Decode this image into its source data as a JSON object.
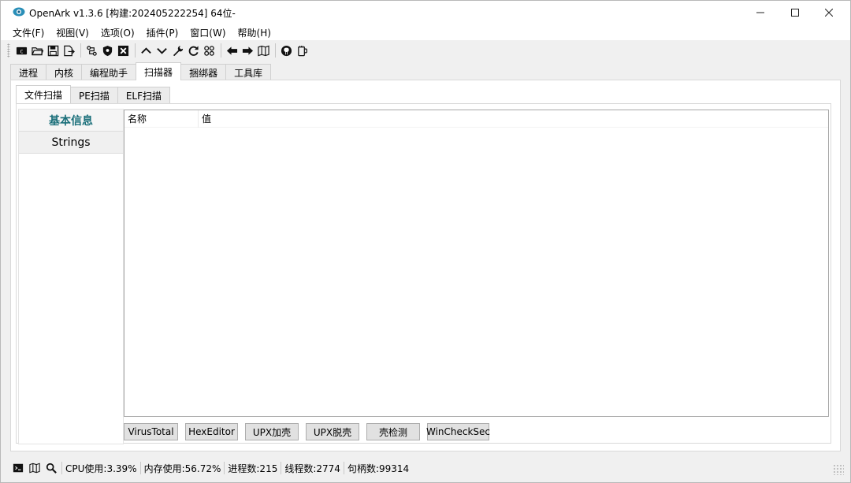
{
  "window": {
    "title": "OpenArk v1.3.6 [构建:202405222254]  64位-",
    "controls": [
      "minimize",
      "maximize",
      "close"
    ],
    "accent_color": "#1a6f7a"
  },
  "menu": [
    "文件(F)",
    "视图(V)",
    "选项(O)",
    "插件(P)",
    "窗口(W)",
    "帮助(H)"
  ],
  "toolbar": {
    "icons": [
      "console-icon",
      "open-folder-icon",
      "save-icon",
      "export-icon",
      "process-icon",
      "shield-icon",
      "kill-icon",
      "up-arrow-icon",
      "down-arrow-icon",
      "wrench-icon",
      "refresh-icon",
      "grid-icon",
      "back-arrow-icon",
      "forward-arrow-icon",
      "map-icon",
      "github-icon",
      "mug-icon"
    ]
  },
  "main_tabs": [
    "进程",
    "内核",
    "编程助手",
    "扫描器",
    "捆绑器",
    "工具库"
  ],
  "active_main_tab": "扫描器",
  "sub_tabs": [
    "文件扫描",
    "PE扫描",
    "ELF扫描"
  ],
  "active_sub_tab": "文件扫描",
  "side_list": [
    "基本信息",
    "Strings"
  ],
  "selected_side_item": "基本信息",
  "table": {
    "columns": [
      "名称",
      "值"
    ],
    "rows": []
  },
  "action_buttons": [
    "VirusTotal",
    "HexEditor",
    "UPX加壳",
    "UPX脱壳",
    "壳检测",
    "WinCheckSec"
  ],
  "status": {
    "cpu": "CPU使用:3.39%",
    "memory": "内存使用:56.72%",
    "processes": "进程数:215",
    "threads": "线程数:2774",
    "handles": "句柄数:99314"
  }
}
